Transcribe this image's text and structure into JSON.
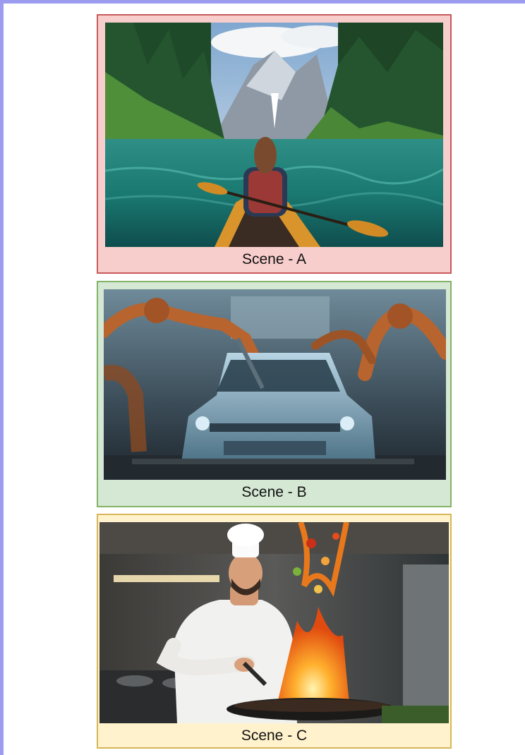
{
  "panels": [
    {
      "caption": "Scene - A",
      "border_color": "#c85a5a",
      "fill_color": "#f8cecc",
      "image": "kayak-lake-mountains-photo"
    },
    {
      "caption": "Scene - B",
      "border_color": "#82b366",
      "fill_color": "#d5e8d4",
      "image": "robot-car-assembly-photo"
    },
    {
      "caption": "Scene - C",
      "border_color": "#d6b656",
      "fill_color": "#fff2cc",
      "image": "chef-flaming-wok-photo"
    }
  ],
  "frame_color": "#9b9bef"
}
